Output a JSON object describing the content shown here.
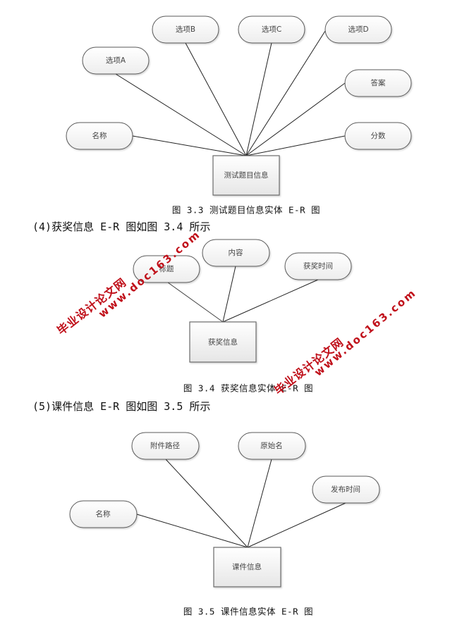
{
  "figures": [
    {
      "entity": "测试题目信息",
      "attributes": [
        "选项A",
        "选项B",
        "选项C",
        "选项D",
        "答案",
        "分数",
        "名称"
      ],
      "caption": "图 3.3 测试题目信息实体 E-R 图"
    },
    {
      "intro": "(4)获奖信息 E-R 图如图 3.4 所示",
      "entity": "获奖信息",
      "attributes": [
        "标题",
        "内容",
        "获奖时间"
      ],
      "caption": "图 3.4 获奖信息实体 E-R 图"
    },
    {
      "intro": "(5)课件信息 E-R 图如图 3.5 所示",
      "entity": "课件信息",
      "attributes": [
        "附件路径",
        "原始名",
        "发布时间",
        "名称"
      ],
      "caption": "图 3.5 课件信息实体 E-R 图"
    }
  ],
  "watermark": {
    "site_name": "毕业设计论文网",
    "url": "www.doc163.com",
    "color": "#c0101a"
  }
}
